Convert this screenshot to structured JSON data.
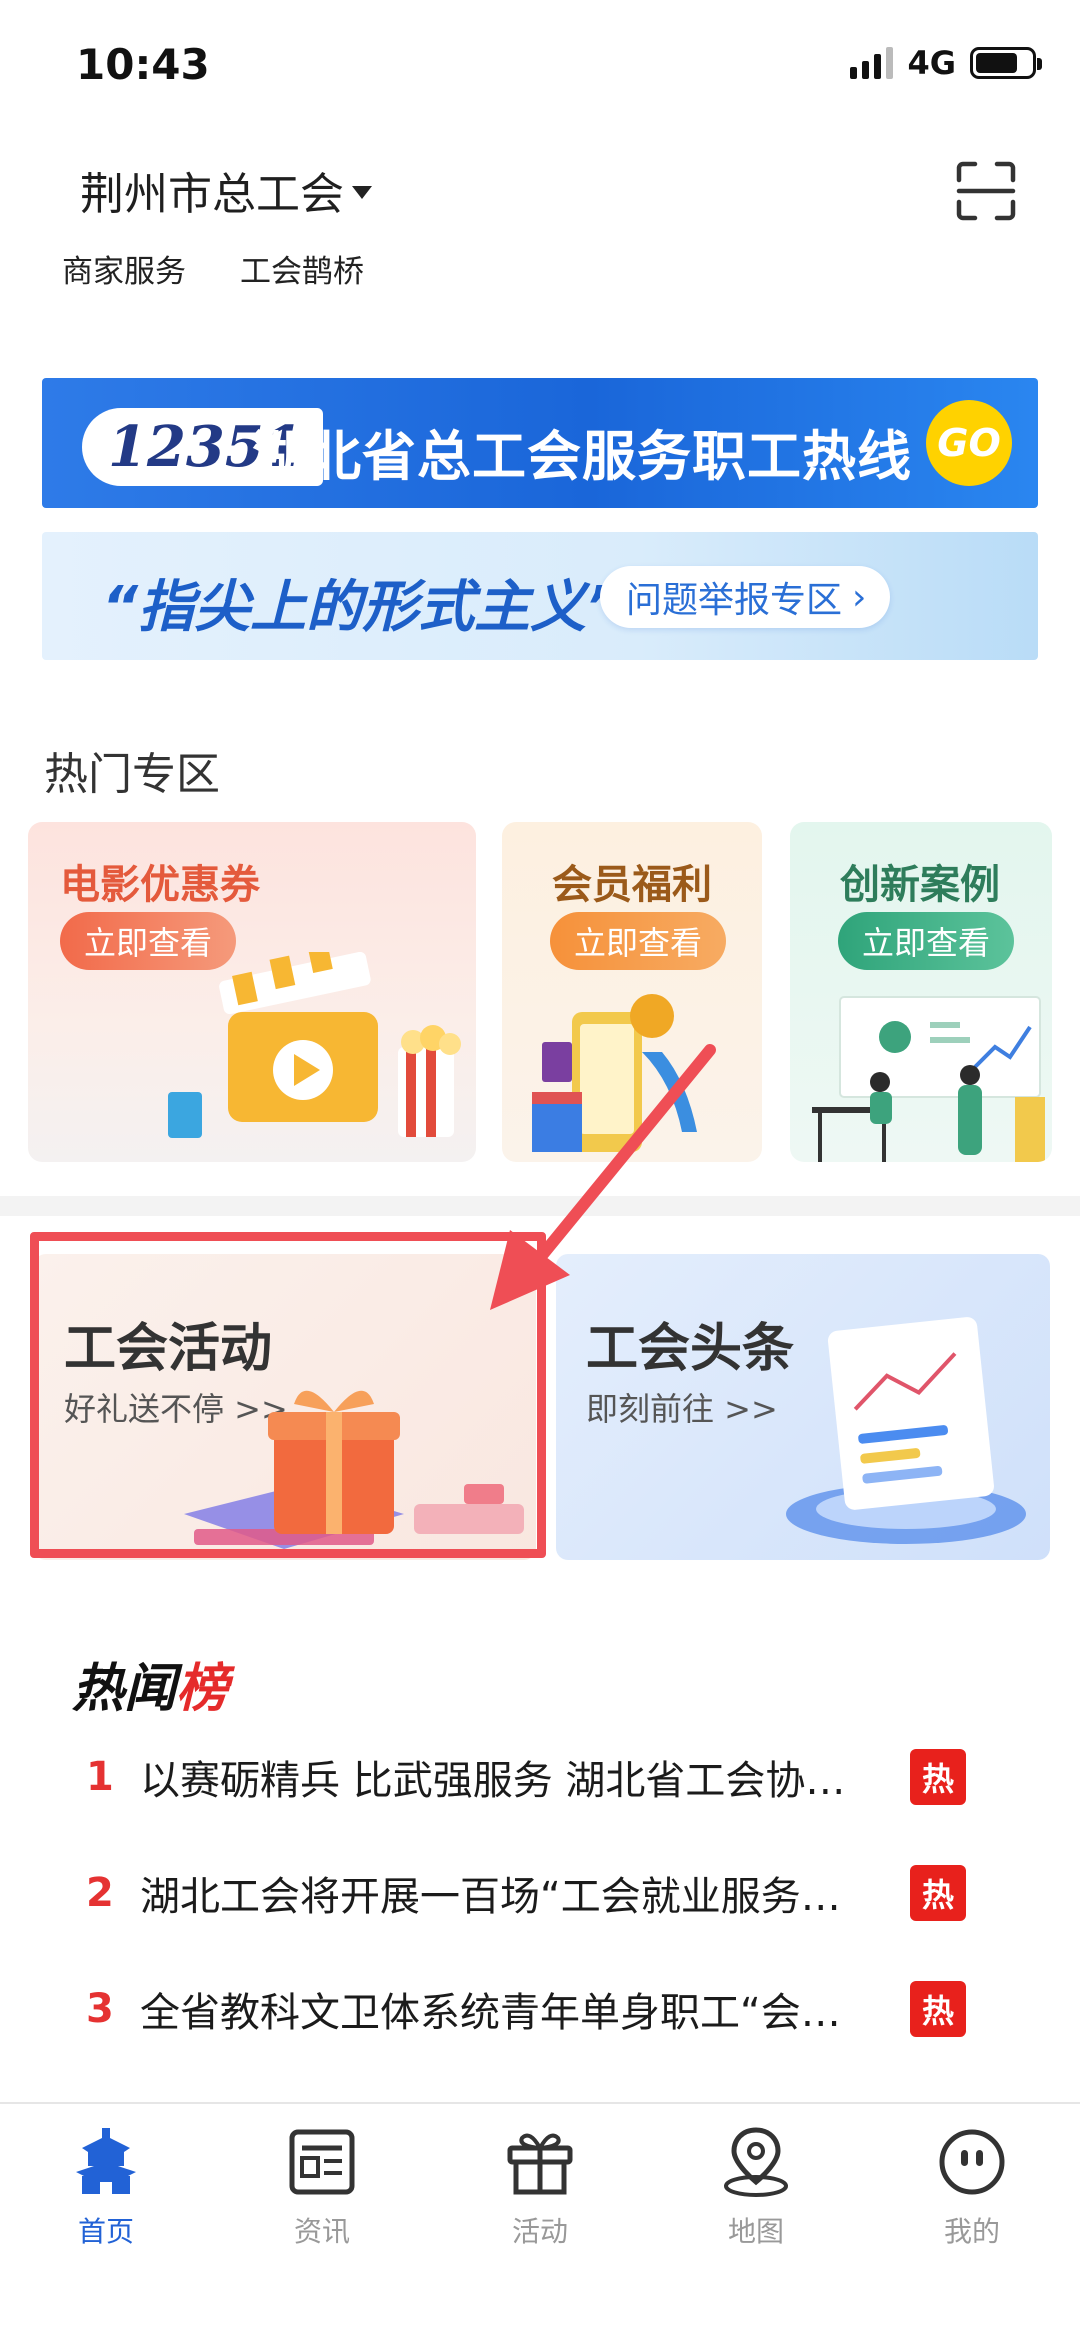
{
  "status_bar": {
    "time": "10:43",
    "network": "4G"
  },
  "header": {
    "org_name": "荆州市总工会",
    "quick_links": [
      "商家服务",
      "工会鹊桥"
    ]
  },
  "banners": {
    "hotline": {
      "number": "12351",
      "title": "湖北省总工会服务职工热线",
      "go": "GO"
    },
    "report": {
      "title": "“指尖上的形式主义”",
      "button": "问题举报专区"
    }
  },
  "hot_zone": {
    "title": "热门专区",
    "cards": [
      {
        "title": "电影优惠券",
        "button": "立即查看"
      },
      {
        "title": "会员福利",
        "button": "立即查看"
      },
      {
        "title": "创新案例",
        "button": "立即查看"
      }
    ]
  },
  "feature_cards": [
    {
      "title": "工会活动",
      "subtitle": "好礼送不停 >>"
    },
    {
      "title": "工会头条",
      "subtitle": "即刻前往 >>"
    }
  ],
  "hot_news": {
    "heading_part1": "热闻",
    "heading_part2": "榜",
    "badge": "热",
    "items": [
      {
        "rank": "1",
        "title": "以赛砺精兵 比武强服务 湖北省工会协…"
      },
      {
        "rank": "2",
        "title": "湖北工会将开展一百场“工会就业服务…"
      },
      {
        "rank": "3",
        "title": "全省教科文卫体系统青年单身职工“会…"
      }
    ]
  },
  "tab_bar": {
    "tabs": [
      {
        "label": "首页",
        "icon": "home-tower-icon",
        "active": true
      },
      {
        "label": "资讯",
        "icon": "news-icon",
        "active": false
      },
      {
        "label": "活动",
        "icon": "gift-icon",
        "active": false
      },
      {
        "label": "地图",
        "icon": "map-pin-icon",
        "active": false
      },
      {
        "label": "我的",
        "icon": "profile-face-icon",
        "active": false
      }
    ]
  },
  "colors": {
    "accent_blue": "#2262d6",
    "highlight_red": "#ef4e55",
    "hot_red": "#e8211c"
  }
}
